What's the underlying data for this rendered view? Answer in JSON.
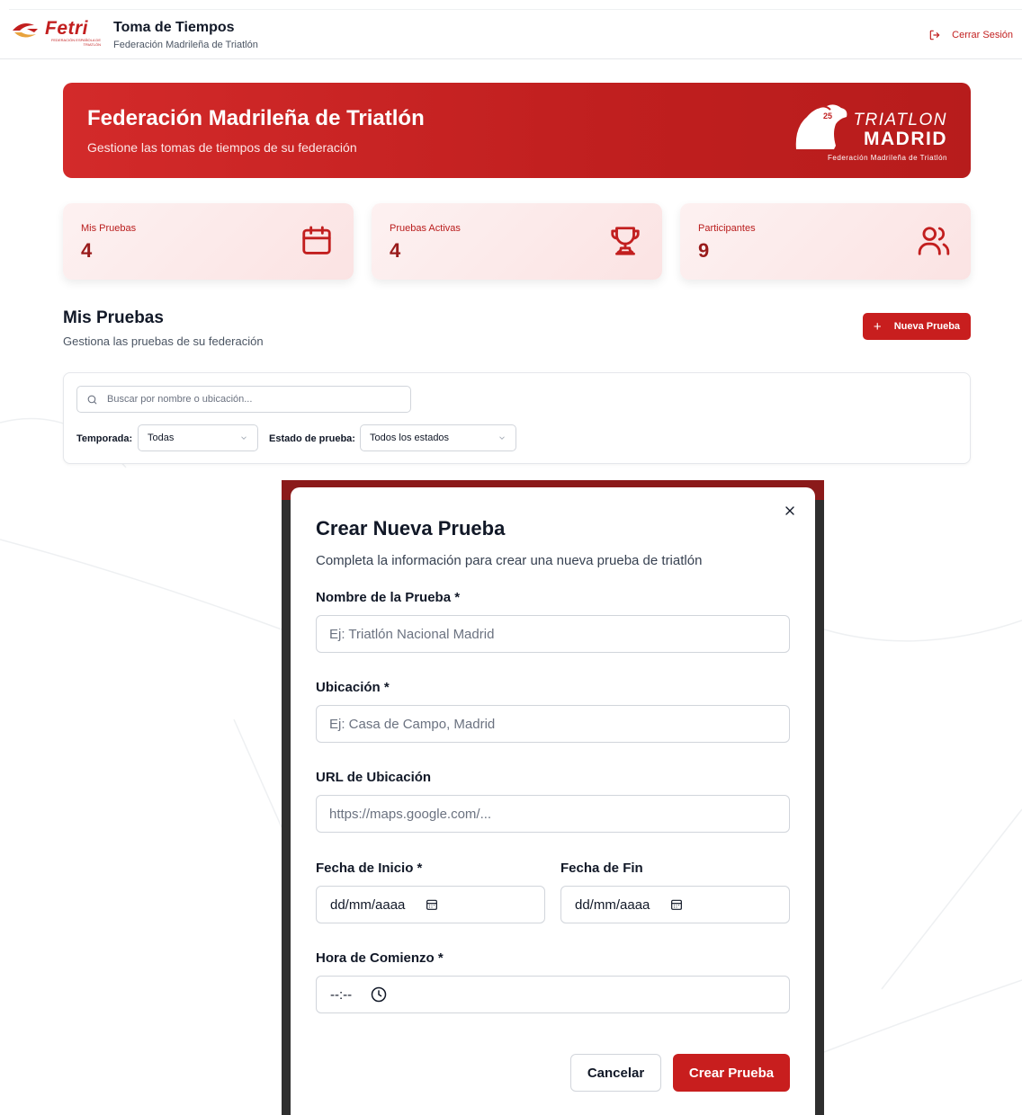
{
  "header": {
    "logo_text": "Fetri",
    "logo_sub": "FEDERACIÓN ESPAÑOLA DE TRIATLÓN",
    "title": "Toma de Tiempos",
    "subtitle": "Federación Madrileña de Triatlón",
    "logout_label": "Cerrar Sesión"
  },
  "banner": {
    "title": "Federación Madrileña de Triatlón",
    "subtitle": "Gestione las tomas de tiempos de su federación",
    "logo_line1": "TRIATLON",
    "logo_line2": "MADRID",
    "logo_line3": "Federación Madrileña de Triatlón"
  },
  "stats": [
    {
      "label": "Mis Pruebas",
      "value": "4",
      "icon": "calendar-icon"
    },
    {
      "label": "Pruebas Activas",
      "value": "4",
      "icon": "trophy-icon"
    },
    {
      "label": "Participantes",
      "value": "9",
      "icon": "users-icon"
    }
  ],
  "section": {
    "title": "Mis Pruebas",
    "subtitle": "Gestiona las pruebas de su federación",
    "new_button": "Nueva Prueba"
  },
  "filters": {
    "search_placeholder": "Buscar por nombre o ubicación...",
    "season_label": "Temporada:",
    "season_value": "Todas",
    "status_label": "Estado de prueba:",
    "status_value": "Todos los estados"
  },
  "modal": {
    "title": "Crear Nueva Prueba",
    "subtitle": "Completa la información para crear una nueva prueba de triatlón",
    "name_label": "Nombre de la Prueba *",
    "name_placeholder": "Ej: Triatlón Nacional Madrid",
    "location_label": "Ubicación *",
    "location_placeholder": "Ej: Casa de Campo, Madrid",
    "url_label": "URL de Ubicación",
    "url_placeholder": "https://maps.google.com/...",
    "start_label": "Fecha de Inicio *",
    "start_placeholder": "dd/mm/aaaa",
    "end_label": "Fecha de Fin",
    "end_placeholder": "dd/mm/aaaa",
    "time_label": "Hora de Comienzo *",
    "time_placeholder": "--:--",
    "cancel_label": "Cancelar",
    "create_label": "Crear Prueba"
  },
  "colors": {
    "brand_red": "#c81e1e",
    "banner_red": "#d32a2a",
    "stat_text": "#991b1b"
  }
}
